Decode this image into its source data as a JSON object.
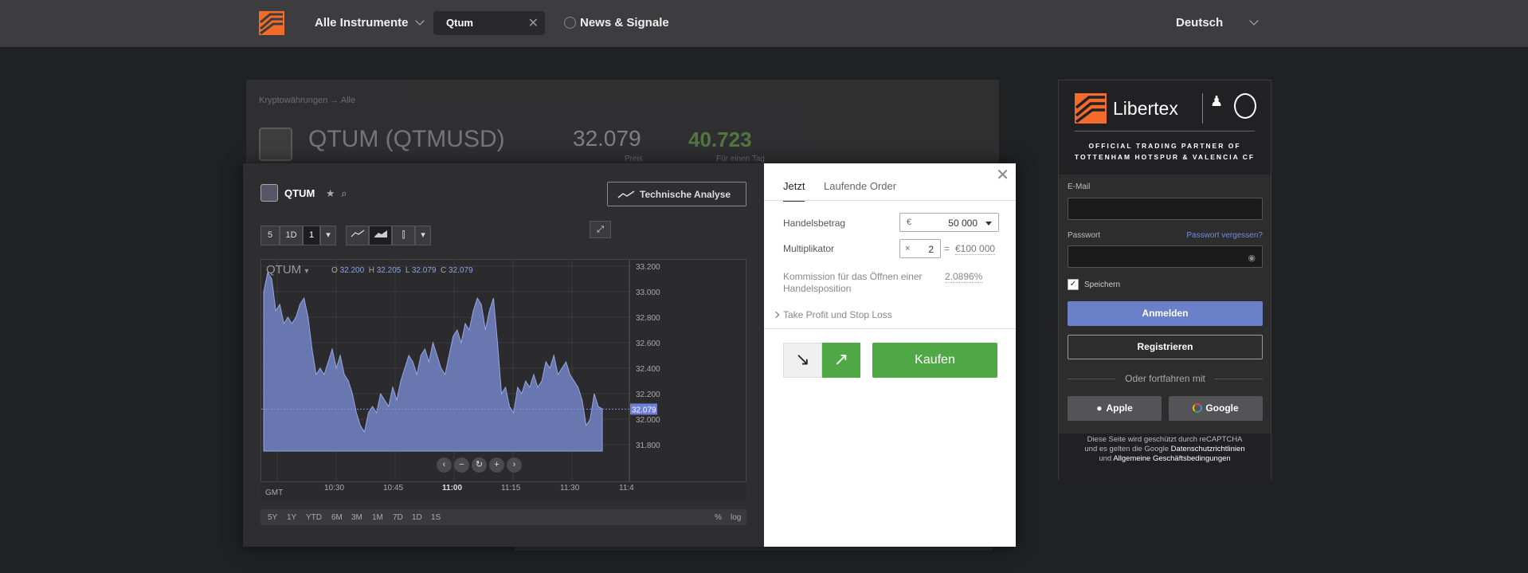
{
  "nav": {
    "instruments": "Alle Instrumente",
    "search_value": "Qtum",
    "news": "News & Signale",
    "language": "Deutsch"
  },
  "background": {
    "breadcrumb": "Kryptowährungen → Alle",
    "title": "QTUM (QTMUSD)",
    "price": "32.079",
    "change": "40.723",
    "price_label": "Preis",
    "change_label": "Für einen Tag"
  },
  "chart_panel": {
    "symbol": "QTUM",
    "ta_button": "Technische Analyse",
    "period_buttons": [
      "5",
      "1D",
      "1"
    ],
    "legend_symbol": "QTUM",
    "ohlc": {
      "o_label": "O",
      "o": "32.200",
      "h_label": "H",
      "h": "32.205",
      "l_label": "L",
      "l": "32.079",
      "c_label": "C",
      "c": "32.079"
    },
    "tz_label": "GMT",
    "ranges": [
      "5Y",
      "1Y",
      "YTD",
      "6M",
      "3M",
      "1M",
      "7D",
      "1D",
      "1S"
    ],
    "percent_label": "%",
    "log_label": "log"
  },
  "chart_data": {
    "type": "area",
    "x_ticks": [
      "10:30",
      "10:45",
      "11:00",
      "11:15",
      "11:30",
      "11:4"
    ],
    "y_ticks": [
      "33.200",
      "33.000",
      "32.800",
      "32.600",
      "32.400",
      "32.200",
      "32.000",
      "31.800"
    ],
    "ylim": [
      31.75,
      33.25
    ],
    "last_value": "32.079",
    "values": [
      33.0,
      33.15,
      33.1,
      32.85,
      32.9,
      32.75,
      32.8,
      32.75,
      32.8,
      32.9,
      32.95,
      32.8,
      32.55,
      32.35,
      32.4,
      32.35,
      32.45,
      32.55,
      32.4,
      32.5,
      32.35,
      32.3,
      32.2,
      32.05,
      31.95,
      31.9,
      32.05,
      32.1,
      32.05,
      32.2,
      32.15,
      32.1,
      32.25,
      32.15,
      32.3,
      32.4,
      32.5,
      32.45,
      32.35,
      32.5,
      32.55,
      32.45,
      32.6,
      32.5,
      32.4,
      32.35,
      32.5,
      32.65,
      32.7,
      32.6,
      32.75,
      32.7,
      32.85,
      32.95,
      32.9,
      32.7,
      32.85,
      32.95,
      32.6,
      32.2,
      32.25,
      32.1,
      32.05,
      32.25,
      32.2,
      32.3,
      32.25,
      32.35,
      32.25,
      32.3,
      32.45,
      32.4,
      32.5,
      32.35,
      32.4,
      32.45,
      32.35,
      32.3,
      32.25,
      32.15,
      31.95,
      32.0,
      32.2,
      32.1,
      32.08
    ],
    "grid": true
  },
  "trade": {
    "tab_now": "Jetzt",
    "tab_orders": "Laufende Order",
    "amount_label": "Handelsbetrag",
    "currency": "€",
    "amount": "50 000",
    "multiplier_label": "Multiplikator",
    "multiplier_sign": "×",
    "multiplier": "2",
    "equals": "=",
    "exposure": "€100 000",
    "commission_label": "Kommission für das Öffnen einer Handelsposition",
    "commission": "2.0896%",
    "tpsl": "Take Profit und Stop Loss",
    "sell_icon": "↘",
    "buy_icon": "↗",
    "buy": "Kaufen"
  },
  "login": {
    "brand": "Libertex",
    "partner_line1": "OFFICIAL TRADING PARTNER OF",
    "partner_line2": "TOTTENHAM HOTSPUR & VALENCIA CF",
    "email_label": "E-Mail",
    "password_label": "Passwort",
    "forgot": "Passwort vergessen?",
    "remember": "Speichern",
    "login_btn": "Anmelden",
    "register_btn": "Registrieren",
    "or_continue": "Oder fortfahren mit",
    "apple": "Apple",
    "google": "Google",
    "legal1": "Diese Seite wird geschützt durch reCAPTCHA",
    "legal2": "und es gelten die Google",
    "legal_link1": "Datenschutzrichtlinien",
    "legal3": "und",
    "legal_link2": "Allgemeine Geschäftsbedingungen"
  },
  "colors": {
    "accent_orange": "#f26b2b",
    "buy_green": "#4fa845",
    "login_blue": "#6a80c8",
    "chart_fill": "#6f7fbf"
  }
}
